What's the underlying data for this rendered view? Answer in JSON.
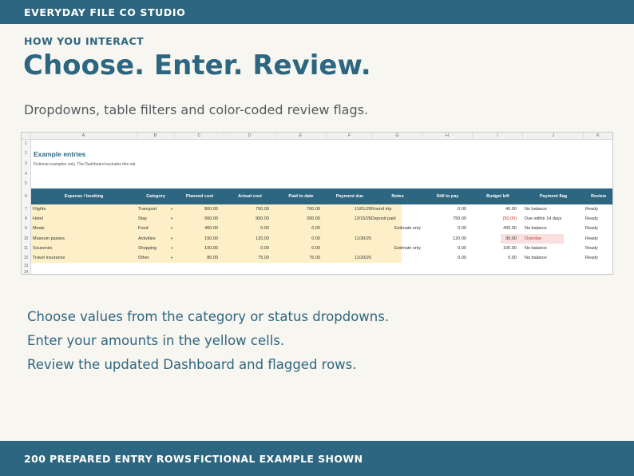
{
  "brand": "EVERYDAY FILE CO STUDIO",
  "eyebrow": "HOW YOU INTERACT",
  "headline": "Choose. Enter. Review.",
  "subline": "Dropdowns, table filters and color-coded review flags.",
  "sheet": {
    "columns": [
      "A",
      "B",
      "C",
      "D",
      "E",
      "F",
      "G",
      "H",
      "I",
      "J",
      "K"
    ],
    "row_numbers": [
      "1",
      "2",
      "3",
      "4",
      "5",
      "6",
      "7",
      "8",
      "9",
      "10",
      "11",
      "12",
      "13",
      "14"
    ],
    "title": "Example entries",
    "note": "Fictional examples only. The Dashboard excludes this tab.",
    "headers": [
      "Expense / booking",
      "Category",
      "Planned cost",
      "Actual cost",
      "Paid to date",
      "Payment due",
      "Notes",
      "Still to pay",
      "Budget left",
      "Payment flag",
      "Review"
    ],
    "rows": [
      {
        "expense": "Flights",
        "category": "Transport",
        "planned": "800.00",
        "actual": "760.00",
        "paid": "760.00",
        "due": "11/01/26",
        "notes": "Round trip",
        "still": "0.00",
        "budget": "40.00",
        "flag": "No balance",
        "review": "Ready"
      },
      {
        "expense": "Hotel",
        "category": "Stay",
        "planned": "900.00",
        "actual": "950.00",
        "paid": "200.00",
        "due": "12/15/26",
        "notes": "Deposit paid",
        "still": "750.00",
        "budget": "(50.00)",
        "flag": "Due within 14 days",
        "review": "Ready"
      },
      {
        "expense": "Meals",
        "category": "Food",
        "planned": "400.00",
        "actual": "0.00",
        "paid": "0.00",
        "due": "",
        "notes": "Estimate only",
        "still": "0.00",
        "budget": "400.00",
        "flag": "No balance",
        "review": "Ready"
      },
      {
        "expense": "Museum passes",
        "category": "Activities",
        "planned": "150.00",
        "actual": "120.00",
        "paid": "0.00",
        "due": "11/30/26",
        "notes": "",
        "still": "120.00",
        "budget": "30.00",
        "flag": "Overdue",
        "review": "Ready"
      },
      {
        "expense": "Souvenirs",
        "category": "Shopping",
        "planned": "100.00",
        "actual": "0.00",
        "paid": "0.00",
        "due": "",
        "notes": "Estimate only",
        "still": "0.00",
        "budget": "100.00",
        "flag": "No balance",
        "review": "Ready"
      },
      {
        "expense": "Travel insurance",
        "category": "Other",
        "planned": "80.00",
        "actual": "75.00",
        "paid": "75.00",
        "due": "11/20/26",
        "notes": "",
        "still": "0.00",
        "budget": "5.00",
        "flag": "No balance",
        "review": "Ready"
      }
    ]
  },
  "steps": [
    "Choose values from the category or status dropdowns.",
    "Enter your amounts in the yellow cells.",
    "Review the updated Dashboard and flagged rows."
  ],
  "footer": {
    "left": "200 PREPARED ENTRY ROWS",
    "right": "FICTIONAL EXAMPLE SHOWN"
  },
  "colors": {
    "brand": "#2d6680",
    "input_cell": "#fdf0c8",
    "overdue_highlight": "#f9e0df",
    "negative_value": "#b03a3a"
  }
}
